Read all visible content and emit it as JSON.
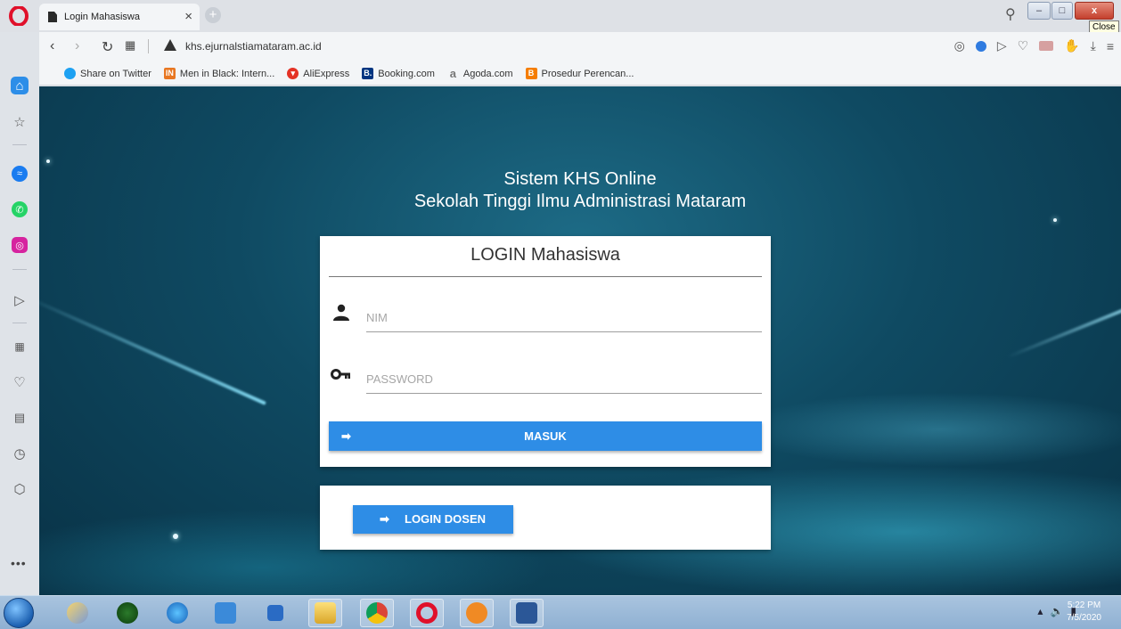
{
  "browser": {
    "tab_title": "Login Mahasiswa",
    "tab_close": "×",
    "new_tab": "+",
    "url": "khs.ejurnalstiamataram.ac.id",
    "tooltip": "Close",
    "window_min": "–",
    "window_max": "□",
    "window_close": "x"
  },
  "bookmarks": [
    {
      "label": "Share on Twitter",
      "icon": "twitter-icon",
      "color": "#1da1f2",
      "glyph": ""
    },
    {
      "label": "Men in Black: Intern...",
      "icon": "imdb-icon",
      "color": "#e87722",
      "glyph": "IN"
    },
    {
      "label": "AliExpress",
      "icon": "aliexpress-icon",
      "color": "#e43225",
      "glyph": "▾"
    },
    {
      "label": "Booking.com",
      "icon": "booking-icon",
      "color": "#003580",
      "glyph": "B."
    },
    {
      "label": "Agoda.com",
      "icon": "agoda-icon",
      "color": "#888888",
      "glyph": "a"
    },
    {
      "label": "Prosedur Perencan...",
      "icon": "blogger-icon",
      "color": "#f57d00",
      "glyph": "B"
    }
  ],
  "page": {
    "title_line1": "Sistem KHS Online",
    "title_line2": "Sekolah Tinggi Ilmu Administrasi Mataram",
    "login_heading": "LOGIN Mahasiswa",
    "nim_placeholder": "NIM",
    "password_placeholder": "PASSWORD",
    "masuk_label": "MASUK",
    "dosen_label": "LOGIN DOSEN",
    "accent_color": "#2e8de6"
  },
  "taskbar": {
    "time": "5:22 PM",
    "date": "7/5/2020"
  }
}
